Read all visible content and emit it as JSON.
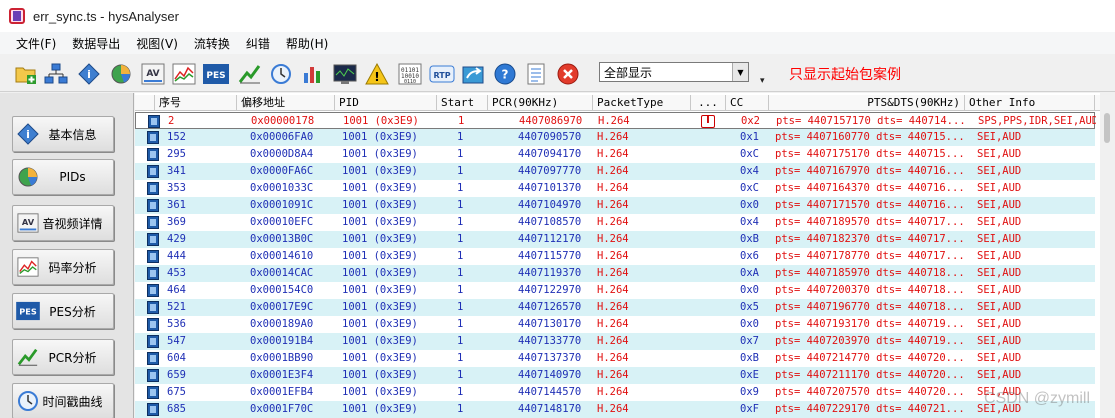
{
  "window": {
    "title": "err_sync.ts - hysAnalyser"
  },
  "menu": [
    "文件(F)",
    "数据导出",
    "视图(V)",
    "流转换",
    "纠错",
    "帮助(H)"
  ],
  "toolbar": {
    "filter_value": "全部显示",
    "note": "只显示起始包案例",
    "icons": [
      "open-folder-icon",
      "network-icon",
      "info-icon",
      "pie-chart-icon",
      "av-icon",
      "bitrate-chart-icon",
      "pes-icon",
      "pcr-icon",
      "clock-icon",
      "bar-chart-icon",
      "monitor-icon",
      "warning-icon",
      "binary-icon",
      "rtp-icon",
      "export-icon",
      "help-icon",
      "notes-icon",
      "close-icon"
    ]
  },
  "sidebar": [
    {
      "label": "基本信息",
      "icon": "info-icon"
    },
    {
      "label": "PIDs",
      "icon": "pie-chart-icon"
    },
    {
      "label": "音视频详情",
      "icon": "av-icon"
    },
    {
      "label": "码率分析",
      "icon": "bitrate-chart-icon"
    },
    {
      "label": "PES分析",
      "icon": "pes-icon"
    },
    {
      "label": "PCR分析",
      "icon": "pcr-icon"
    },
    {
      "label": "时间戳曲线",
      "icon": "clock-icon"
    }
  ],
  "table": {
    "columns": [
      "序号",
      "偏移地址",
      "PID",
      "Start",
      "PCR(90KHz)",
      "PacketType",
      "...",
      "CC",
      "PTS&DTS(90KHz)",
      "Other Info"
    ],
    "rows": [
      {
        "no": "2",
        "offset": "0x00000178",
        "pid": "1001 (0x3E9)",
        "start": "1",
        "pcr": "4407086970",
        "type": "H.264",
        "mark": "I",
        "cc": "0x2",
        "pts": "pts= 4407157170 dts= 440714...",
        "info": "SPS,PPS,IDR,SEI,AUD"
      },
      {
        "no": "152",
        "offset": "0x00006FA0",
        "pid": "1001 (0x3E9)",
        "start": "1",
        "pcr": "4407090570",
        "type": "H.264",
        "mark": "",
        "cc": "0x1",
        "pts": "pts= 4407160770 dts= 440715...",
        "info": "SEI,AUD"
      },
      {
        "no": "295",
        "offset": "0x0000D8A4",
        "pid": "1001 (0x3E9)",
        "start": "1",
        "pcr": "4407094170",
        "type": "H.264",
        "mark": "",
        "cc": "0xC",
        "pts": "pts= 4407175170 dts= 440715...",
        "info": "SEI,AUD"
      },
      {
        "no": "341",
        "offset": "0x0000FA6C",
        "pid": "1001 (0x3E9)",
        "start": "1",
        "pcr": "4407097770",
        "type": "H.264",
        "mark": "",
        "cc": "0x4",
        "pts": "pts= 4407167970 dts= 440716...",
        "info": "SEI,AUD"
      },
      {
        "no": "353",
        "offset": "0x0001033C",
        "pid": "1001 (0x3E9)",
        "start": "1",
        "pcr": "4407101370",
        "type": "H.264",
        "mark": "",
        "cc": "0xC",
        "pts": "pts= 4407164370 dts= 440716...",
        "info": "SEI,AUD"
      },
      {
        "no": "361",
        "offset": "0x0001091C",
        "pid": "1001 (0x3E9)",
        "start": "1",
        "pcr": "4407104970",
        "type": "H.264",
        "mark": "",
        "cc": "0x0",
        "pts": "pts= 4407171570 dts= 440716...",
        "info": "SEI,AUD"
      },
      {
        "no": "369",
        "offset": "0x00010EFC",
        "pid": "1001 (0x3E9)",
        "start": "1",
        "pcr": "4407108570",
        "type": "H.264",
        "mark": "",
        "cc": "0x4",
        "pts": "pts= 4407189570 dts= 440717...",
        "info": "SEI,AUD"
      },
      {
        "no": "429",
        "offset": "0x00013B0C",
        "pid": "1001 (0x3E9)",
        "start": "1",
        "pcr": "4407112170",
        "type": "H.264",
        "mark": "",
        "cc": "0xB",
        "pts": "pts= 4407182370 dts= 440717...",
        "info": "SEI,AUD"
      },
      {
        "no": "444",
        "offset": "0x00014610",
        "pid": "1001 (0x3E9)",
        "start": "1",
        "pcr": "4407115770",
        "type": "H.264",
        "mark": "",
        "cc": "0x6",
        "pts": "pts= 4407178770 dts= 440717...",
        "info": "SEI,AUD"
      },
      {
        "no": "453",
        "offset": "0x00014CAC",
        "pid": "1001 (0x3E9)",
        "start": "1",
        "pcr": "4407119370",
        "type": "H.264",
        "mark": "",
        "cc": "0xA",
        "pts": "pts= 4407185970 dts= 440718...",
        "info": "SEI,AUD"
      },
      {
        "no": "464",
        "offset": "0x000154C0",
        "pid": "1001 (0x3E9)",
        "start": "1",
        "pcr": "4407122970",
        "type": "H.264",
        "mark": "",
        "cc": "0x0",
        "pts": "pts= 4407200370 dts= 440718...",
        "info": "SEI,AUD"
      },
      {
        "no": "521",
        "offset": "0x00017E9C",
        "pid": "1001 (0x3E9)",
        "start": "1",
        "pcr": "4407126570",
        "type": "H.264",
        "mark": "",
        "cc": "0x5",
        "pts": "pts= 4407196770 dts= 440718...",
        "info": "SEI,AUD"
      },
      {
        "no": "536",
        "offset": "0x000189A0",
        "pid": "1001 (0x3E9)",
        "start": "1",
        "pcr": "4407130170",
        "type": "H.264",
        "mark": "",
        "cc": "0x0",
        "pts": "pts= 4407193170 dts= 440719...",
        "info": "SEI,AUD"
      },
      {
        "no": "547",
        "offset": "0x000191B4",
        "pid": "1001 (0x3E9)",
        "start": "1",
        "pcr": "4407133770",
        "type": "H.264",
        "mark": "",
        "cc": "0x7",
        "pts": "pts= 4407203970 dts= 440719...",
        "info": "SEI,AUD"
      },
      {
        "no": "604",
        "offset": "0x0001BB90",
        "pid": "1001 (0x3E9)",
        "start": "1",
        "pcr": "4407137370",
        "type": "H.264",
        "mark": "",
        "cc": "0xB",
        "pts": "pts= 4407214770 dts= 440720...",
        "info": "SEI,AUD"
      },
      {
        "no": "659",
        "offset": "0x0001E3F4",
        "pid": "1001 (0x3E9)",
        "start": "1",
        "pcr": "4407140970",
        "type": "H.264",
        "mark": "",
        "cc": "0xE",
        "pts": "pts= 4407211170 dts= 440720...",
        "info": "SEI,AUD"
      },
      {
        "no": "675",
        "offset": "0x0001EFB4",
        "pid": "1001 (0x3E9)",
        "start": "1",
        "pcr": "4407144570",
        "type": "H.264",
        "mark": "",
        "cc": "0x9",
        "pts": "pts= 4407207570 dts= 440720...",
        "info": "SEI,AUD"
      },
      {
        "no": "685",
        "offset": "0x0001F70C",
        "pid": "1001 (0x3E9)",
        "start": "1",
        "pcr": "4407148170",
        "type": "H.264",
        "mark": "",
        "cc": "0xF",
        "pts": "pts= 4407229170 dts= 440721...",
        "info": "SEI,AUD"
      }
    ]
  },
  "watermark": "CSDN @zymill",
  "colors": {
    "row_alt": "#d8f2f6",
    "text_blue": "#1f2fb5",
    "text_red": "#e01010",
    "note_red": "#ff0000"
  }
}
